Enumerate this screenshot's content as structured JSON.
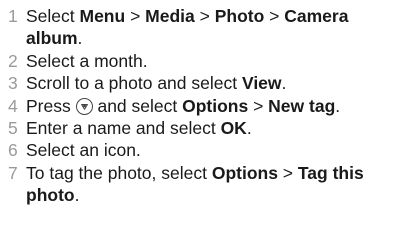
{
  "steps": [
    {
      "num": "1",
      "parts": [
        {
          "t": "Select "
        },
        {
          "t": "Menu",
          "b": true
        },
        {
          "t": " > "
        },
        {
          "t": "Media",
          "b": true
        },
        {
          "t": " > "
        },
        {
          "t": "Photo",
          "b": true
        },
        {
          "t": " > "
        },
        {
          "t": "Camera album",
          "b": true
        },
        {
          "t": "."
        }
      ]
    },
    {
      "num": "2",
      "parts": [
        {
          "t": "Select a month."
        }
      ]
    },
    {
      "num": "3",
      "parts": [
        {
          "t": "Scroll to a photo and select "
        },
        {
          "t": "View",
          "b": true
        },
        {
          "t": "."
        }
      ]
    },
    {
      "num": "4",
      "parts": [
        {
          "t": "Press "
        },
        {
          "icon": "navigation-key-icon"
        },
        {
          "t": " and select "
        },
        {
          "t": "Options",
          "b": true
        },
        {
          "t": " > "
        },
        {
          "t": "New tag",
          "b": true
        },
        {
          "t": "."
        }
      ]
    },
    {
      "num": "5",
      "parts": [
        {
          "t": "Enter a name and select "
        },
        {
          "t": "OK",
          "b": true
        },
        {
          "t": "."
        }
      ]
    },
    {
      "num": "6",
      "parts": [
        {
          "t": "Select an icon."
        }
      ]
    },
    {
      "num": "7",
      "parts": [
        {
          "t": "To tag the photo, select "
        },
        {
          "t": "Options",
          "b": true
        },
        {
          "t": " > "
        },
        {
          "t": "Tag this photo",
          "b": true
        },
        {
          "t": "."
        }
      ]
    }
  ],
  "colors": {
    "number": "#9a9a9a",
    "text": "#1a1a1a"
  }
}
